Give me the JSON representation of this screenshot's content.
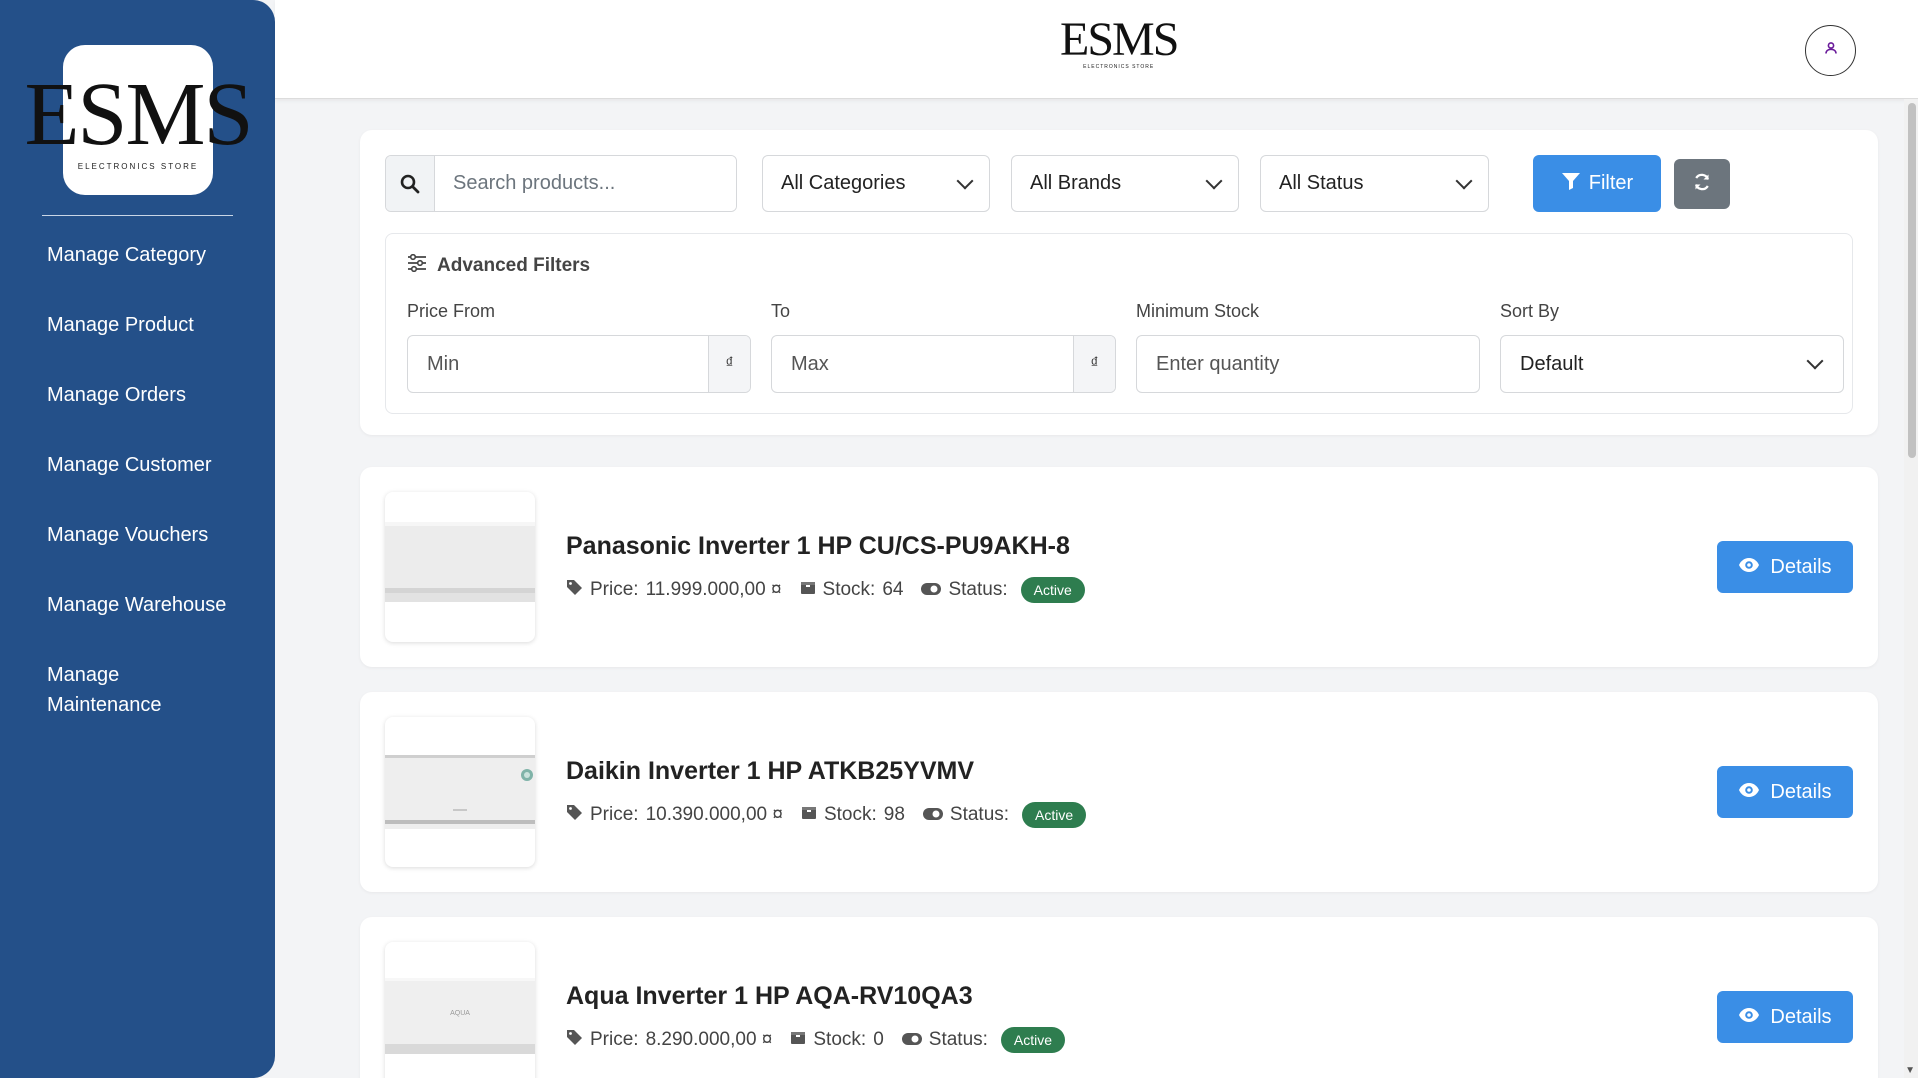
{
  "brand": {
    "logo_text": "ESMS",
    "logo_subtext": "ELECTRONICS STORE"
  },
  "sidebar": {
    "items": [
      {
        "label": "Manage Category"
      },
      {
        "label": "Manage Product"
      },
      {
        "label": "Manage Orders"
      },
      {
        "label": "Manage Customer"
      },
      {
        "label": "Manage Vouchers"
      },
      {
        "label": "Manage Warehouse"
      },
      {
        "label": "Manage Maintenance"
      }
    ]
  },
  "header": {
    "user_icon": "user-icon"
  },
  "filters": {
    "search_placeholder": "Search products...",
    "category_value": "All Categories",
    "brand_value": "All Brands",
    "status_value": "All Status",
    "filter_label": "Filter",
    "reset_icon": "refresh-icon",
    "advanced": {
      "title": "Advanced Filters",
      "price_from_label": "Price From",
      "price_from_placeholder": "Min",
      "price_to_label": "To",
      "price_to_placeholder": "Max",
      "currency_symbol": "₫",
      "min_stock_label": "Minimum Stock",
      "min_stock_placeholder": "Enter quantity",
      "sort_label": "Sort By",
      "sort_value": "Default"
    }
  },
  "products": [
    {
      "name": "Panasonic Inverter 1 HP CU/CS-PU9AKH-8",
      "price_label": "Price:",
      "price": "11.999.000,00 ¤",
      "stock_label": "Stock:",
      "stock": "64",
      "status_label": "Status:",
      "status": "Active",
      "details_label": "Details"
    },
    {
      "name": "Daikin Inverter 1 HP ATKB25YVMV",
      "price_label": "Price:",
      "price": "10.390.000,00 ¤",
      "stock_label": "Stock:",
      "stock": "98",
      "status_label": "Status:",
      "status": "Active",
      "details_label": "Details"
    },
    {
      "name": "Aqua Inverter 1 HP AQA-RV10QA3",
      "price_label": "Price:",
      "price": "8.290.000,00 ¤",
      "stock_label": "Stock:",
      "stock": "0",
      "status_label": "Status:",
      "status": "Active",
      "details_label": "Details",
      "thumb_text": "AQUA"
    }
  ],
  "colors": {
    "sidebar": "#245089",
    "primary": "#3a8ee6",
    "active_badge": "#2e7d4f",
    "secondary": "#6c757d"
  }
}
